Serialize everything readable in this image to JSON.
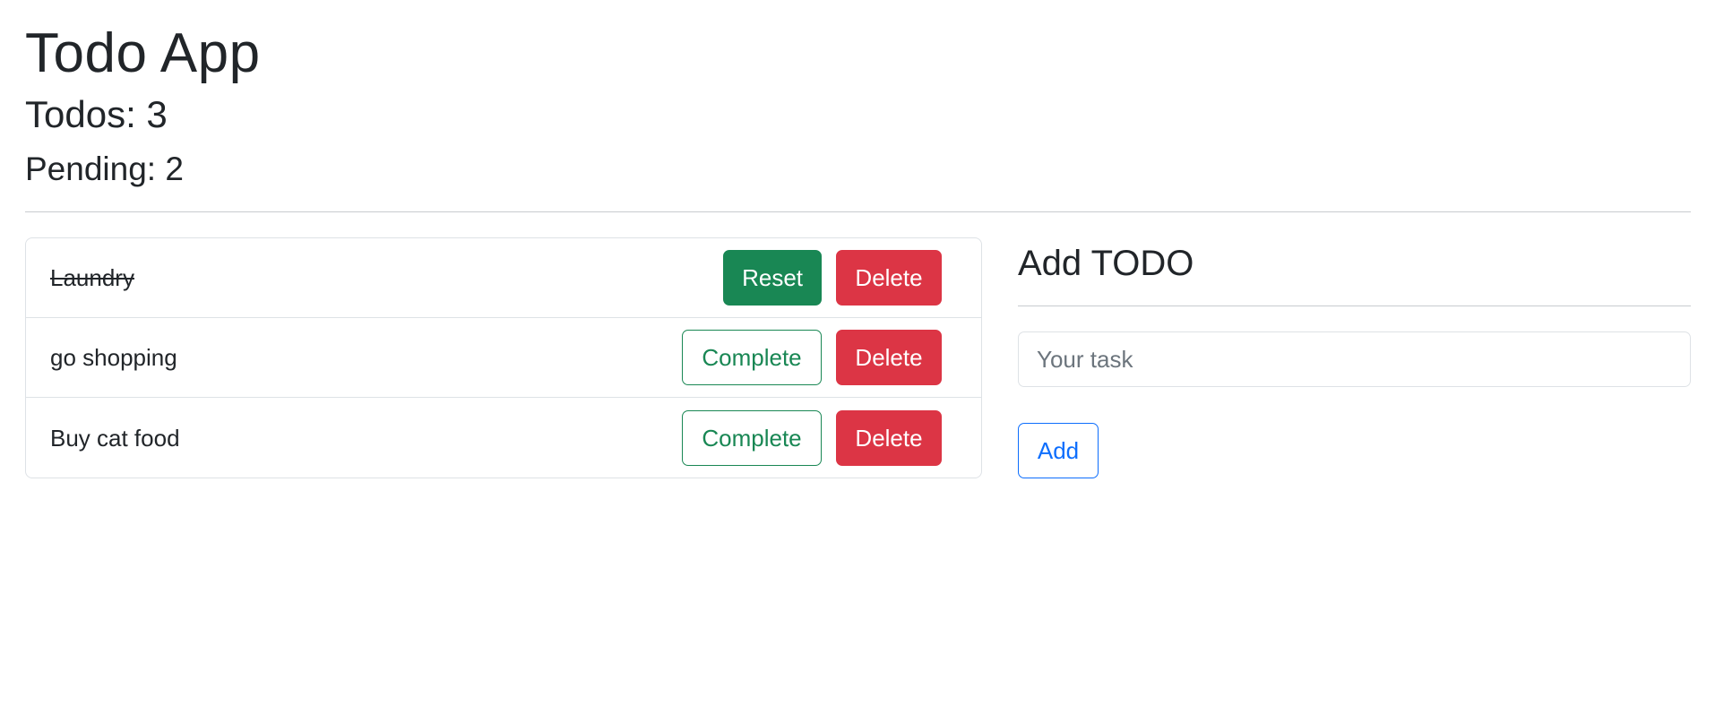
{
  "app": {
    "title": "Todo App",
    "todos_count_text": "Todos: 3",
    "pending_count_text": "Pending: 2"
  },
  "todos": [
    {
      "text": "Laundry",
      "completed": true,
      "toggle_label": "Reset",
      "delete_label": "Delete"
    },
    {
      "text": "go shopping",
      "completed": false,
      "toggle_label": "Complete",
      "delete_label": "Delete"
    },
    {
      "text": "Buy cat food",
      "completed": false,
      "toggle_label": "Complete",
      "delete_label": "Delete"
    }
  ],
  "add_form": {
    "title": "Add TODO",
    "input_value": "",
    "input_placeholder": "Your task",
    "add_label": "Add"
  },
  "colors": {
    "success": "#198754",
    "danger": "#dc3545",
    "primary": "#0d6efd",
    "text": "#212529",
    "border": "#dee2e6"
  }
}
